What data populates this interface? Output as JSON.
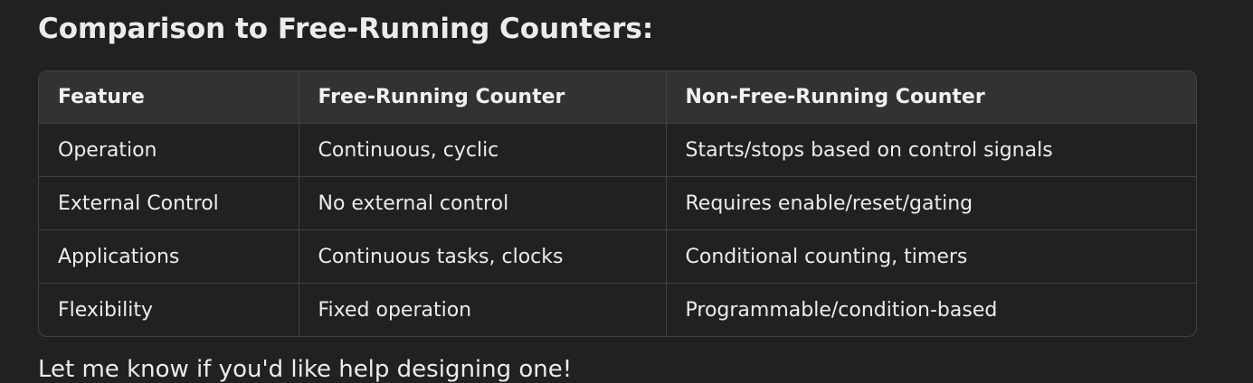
{
  "heading": "Comparison to Free-Running Counters:",
  "table": {
    "headers": [
      "Feature",
      "Free-Running Counter",
      "Non-Free-Running Counter"
    ],
    "rows": [
      [
        "Operation",
        "Continuous, cyclic",
        "Starts/stops based on control signals"
      ],
      [
        "External Control",
        "No external control",
        "Requires enable/reset/gating"
      ],
      [
        "Applications",
        "Continuous tasks, clocks",
        "Conditional counting, timers"
      ],
      [
        "Flexibility",
        "Fixed operation",
        "Programmable/condition-based"
      ]
    ]
  },
  "trailing_text": "Let me know if you'd like help designing one!"
}
